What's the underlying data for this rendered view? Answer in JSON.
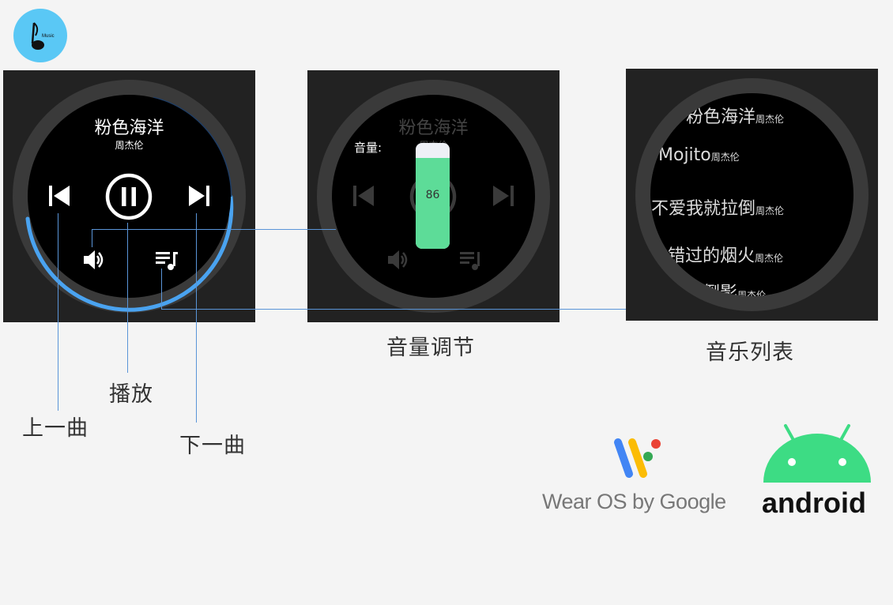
{
  "app_icon": {
    "label": "Music",
    "color": "#5ac8f5"
  },
  "player": {
    "song_title": "粉色海洋",
    "artist": "周杰伦",
    "progress": 0.55,
    "accent": "#4aa3f0",
    "icons": [
      "skip-previous-icon",
      "pause-icon",
      "skip-next-icon",
      "volume-icon",
      "playlist-icon"
    ]
  },
  "volume_screen": {
    "song_title": "粉色海洋",
    "artist": "周杰伦",
    "volume_label": "音量:",
    "volume_value": "86",
    "volume_level": 0.86,
    "bar_color": "#5ddc98"
  },
  "playlist_screen": {
    "items": [
      {
        "title": "粉色海洋",
        "artist": "周杰伦"
      },
      {
        "title": "Mojito",
        "artist": "周杰伦"
      },
      {
        "title": "不爱我就拉倒",
        "artist": "周杰伦"
      },
      {
        "title": "错过的烟火",
        "artist": "周杰伦"
      },
      {
        "title": "倒影",
        "artist": "周杰伦"
      }
    ]
  },
  "captions": {
    "volume": "音量调节",
    "playlist": "音乐列表",
    "play": "播放",
    "prev": "上一曲",
    "next": "下一曲"
  },
  "logos": {
    "wearos": "Wear OS by Google",
    "android": "android",
    "android_color": "#3ddc84"
  }
}
